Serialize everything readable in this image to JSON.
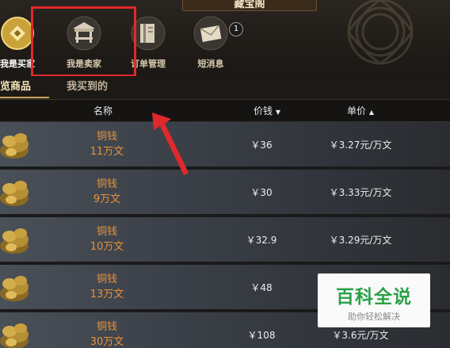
{
  "header": {
    "title": "藏宝阁"
  },
  "nav": [
    {
      "label": "我是买家",
      "icon": "coin-icon"
    },
    {
      "label": "我是卖家",
      "icon": "stall-icon"
    },
    {
      "label": "订单管理",
      "icon": "ledger-icon"
    },
    {
      "label": "短消息",
      "icon": "envelope-icon",
      "badge": "1"
    }
  ],
  "subtabs": {
    "browse": "览商品",
    "bought": "我买到的"
  },
  "table": {
    "columns": {
      "name": "名称",
      "price": "价钱",
      "unit_price": "单价"
    },
    "rows": [
      {
        "item": "铜钱",
        "amount": "11万文",
        "price": "￥36",
        "unit": "￥3.27元/万文"
      },
      {
        "item": "铜钱",
        "amount": "9万文",
        "price": "￥30",
        "unit": "￥3.33元/万文"
      },
      {
        "item": "铜钱",
        "amount": "10万文",
        "price": "￥32.9",
        "unit": "￥3.29元/万文"
      },
      {
        "item": "铜钱",
        "amount": "13万文",
        "price": "￥48",
        "unit": ""
      },
      {
        "item": "铜钱",
        "amount": "30万文",
        "price": "￥108",
        "unit": "￥3.6元/万文"
      }
    ]
  },
  "watermark": {
    "title": "百科全说",
    "subtitle": "助你轻松解决"
  },
  "colors": {
    "item_orange": "#e8913a",
    "highlight_red": "#e0292b",
    "watermark_green": "#2aa248"
  }
}
